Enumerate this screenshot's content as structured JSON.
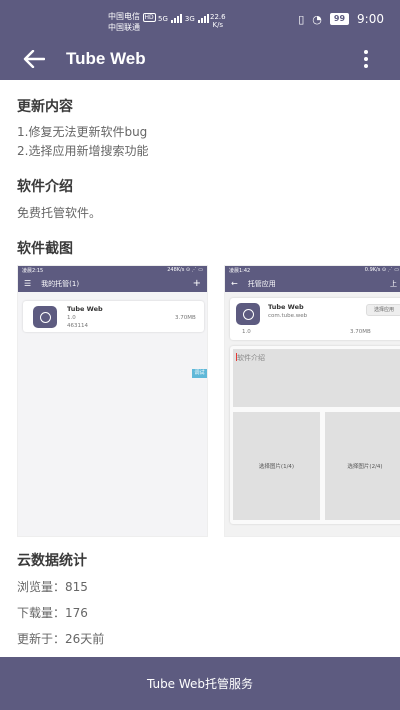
{
  "status_bar": {
    "carrier1": "中国电信",
    "carrier1_badge": "HD",
    "carrier2": "中国联通",
    "net_5g": "5G",
    "net_3g": "3G",
    "speed_value": "22.6",
    "speed_unit": "K/s",
    "battery": "99",
    "time": "9:00"
  },
  "app_bar": {
    "title": "Tube Web"
  },
  "sections": {
    "changelog_title": "更新内容",
    "changelog_lines": [
      "1.修复无法更新软件bug",
      "2.选择应用新增搜索功能"
    ],
    "intro_title": "软件介绍",
    "intro_text": "免费托管软件。",
    "screenshots_title": "软件截图",
    "stats_title": "云数据统计",
    "views": "浏览量：815",
    "downloads": "下载量：176",
    "updated": "更新于：26天前"
  },
  "screenshot1": {
    "status_left": "凌晨2:15",
    "status_right": "248K/s ⊙ ⋰ ▭",
    "title": "我的托管(1)",
    "plus": "+",
    "app_name": "Tube Web",
    "version": "1.0",
    "id": "463114",
    "size": "3.70MB",
    "badge": "调试"
  },
  "screenshot2": {
    "status_left": "凌晨1:42",
    "status_right": "0.9K/s ⊙ ⋰ ▭",
    "title": "托管应用",
    "action": "上",
    "app_name": "Tube Web",
    "package": "com.tube.web",
    "select_app": "选择应用",
    "version": "1.0",
    "size": "3.70MB",
    "intro_placeholder": "软件介绍",
    "pick1": "选择图片(1/4)",
    "pick2": "选择图片(2/4)"
  },
  "bottom_bar": {
    "label": "Tube Web托管服务"
  }
}
